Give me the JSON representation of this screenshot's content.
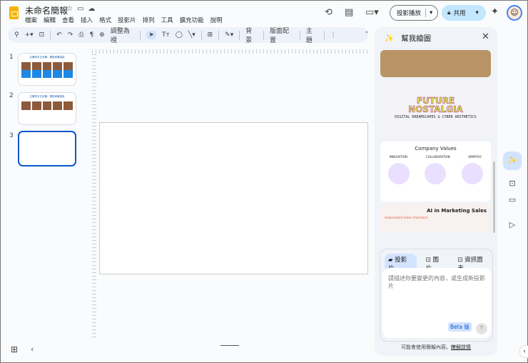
{
  "doc": {
    "title": "未命名簡報",
    "menu": [
      "檔案",
      "編輯",
      "查看",
      "插入",
      "格式",
      "投影片",
      "排列",
      "工具",
      "擴充功能",
      "說明"
    ]
  },
  "header": {
    "present": "投影播放",
    "share": "共用"
  },
  "toolbar": {
    "fit": "調整為視",
    "background": "背景",
    "layout": "版面配置",
    "theme": "主題"
  },
  "slides": [
    {
      "num": "1",
      "title": "正確洗手五步驟：預防病毒感染"
    },
    {
      "num": "2",
      "title": "正確洗手五步驟：預防病毒感染"
    },
    {
      "num": "3"
    }
  ],
  "panel": {
    "title": "幫我繪圖",
    "gallery": {
      "card2_title1": "FUTURE",
      "card2_title2": "NOSTALGIA",
      "card2_sub": "DIGITAL DREAMSCAPES & CYBER AESTHETICS",
      "card3_title": "Company Values",
      "card3_cols": [
        "INNOVATION",
        "COLLABORATION",
        "EMPATHY"
      ],
      "card4_title": "AI in Marketing Sales",
      "card4_item": "Automated Sales Outreach"
    },
    "tabs": [
      "投影片",
      "圖片",
      "資訊圖表"
    ],
    "placeholder": "請描述你要變更的內容，或生成新投影片",
    "beta": "Beta 版",
    "footer": "可能會使用簡報內容。",
    "learn_more": "瞭解詳情"
  }
}
